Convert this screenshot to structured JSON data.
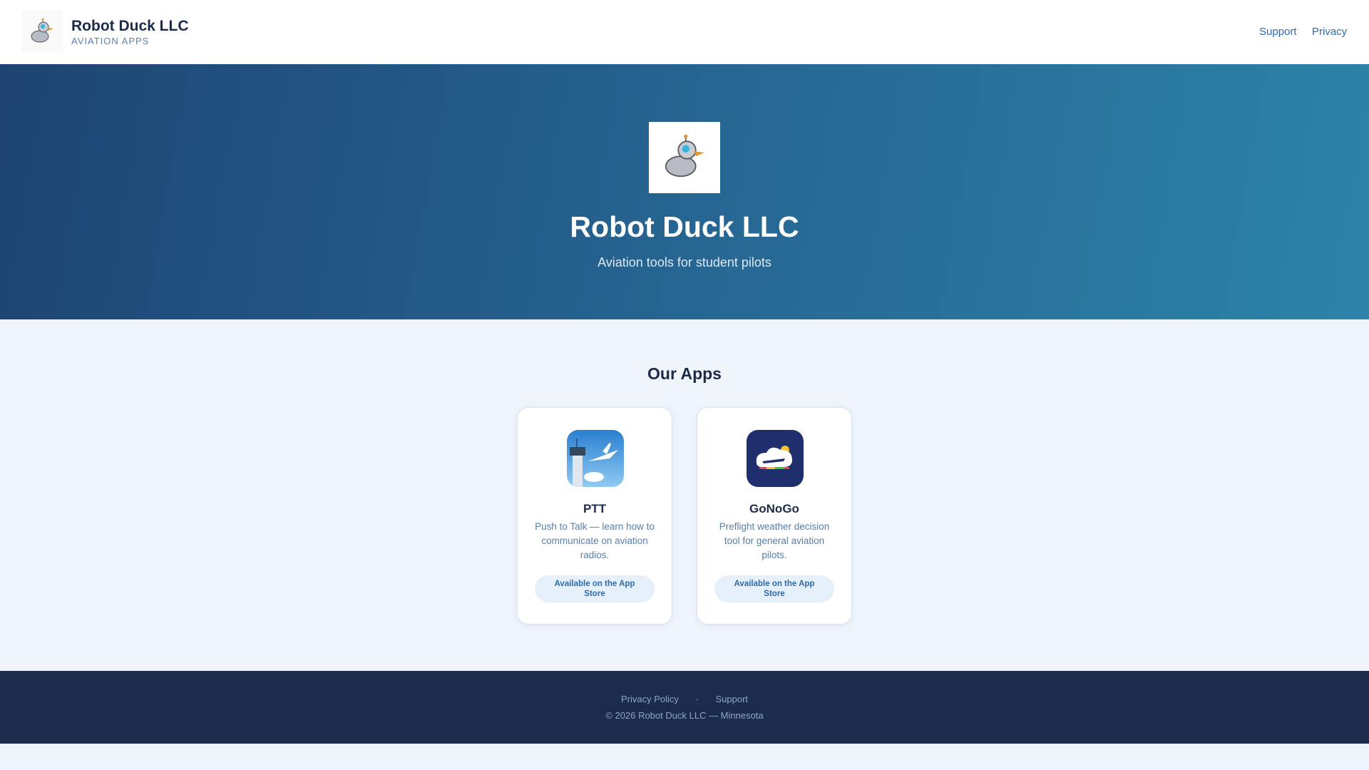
{
  "header": {
    "title": "Robot Duck LLC",
    "subtitle": "AVIATION APPS",
    "nav": [
      {
        "label": "Support"
      },
      {
        "label": "Privacy"
      }
    ],
    "logo_icon": "robot-duck-icon"
  },
  "hero": {
    "title": "Robot Duck LLC",
    "subtitle": "Aviation tools for student pilots"
  },
  "apps": {
    "title": "Our Apps",
    "items": [
      {
        "name": "PTT",
        "description": "Push to Talk — learn how to communicate on aviation radios.",
        "button": "Available on the App Store",
        "icon": "control-tower-airplane-icon"
      },
      {
        "name": "GoNoGo",
        "description": "Preflight weather decision tool for general aviation pilots.",
        "button": "Available on the App Store",
        "icon": "cloud-airplane-icon"
      }
    ]
  },
  "footer": {
    "links": [
      {
        "label": "Privacy Policy"
      },
      {
        "label": "Support"
      }
    ],
    "separator": "·",
    "copyright": "© 2026 Robot Duck LLC — Minnesota"
  },
  "colors": {
    "header_bg": "#ffffff",
    "hero_start": "#1e4473",
    "hero_end": "#2c83a8",
    "footer_bg": "#1c2b4b",
    "link": "#2f6aa8"
  }
}
